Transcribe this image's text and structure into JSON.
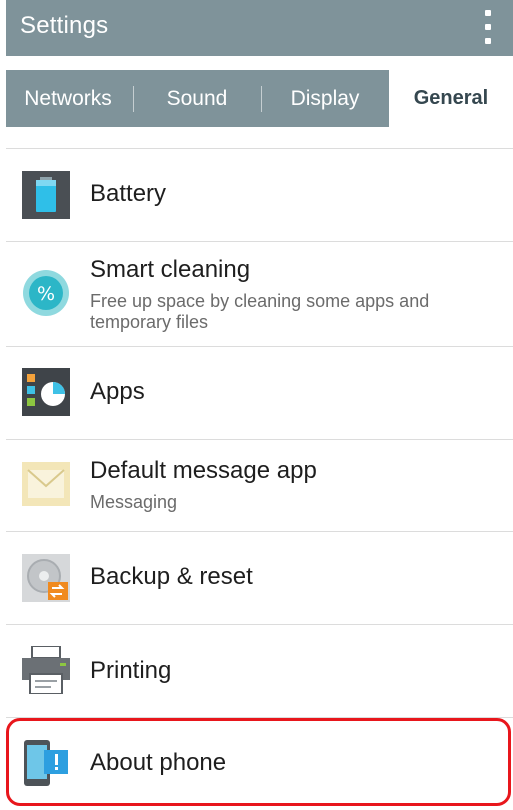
{
  "header": {
    "title": "Settings"
  },
  "tabs": [
    {
      "label": "Networks"
    },
    {
      "label": "Sound"
    },
    {
      "label": "Display"
    },
    {
      "label": "General",
      "active": true
    }
  ],
  "items": [
    {
      "label": "Battery",
      "icon": "battery-icon"
    },
    {
      "label": "Smart cleaning",
      "sub": "Free up space by cleaning some apps and temporary files",
      "icon": "smart-cleaning-icon"
    },
    {
      "label": "Apps",
      "icon": "apps-icon"
    },
    {
      "label": "Default message app",
      "sub": "Messaging",
      "icon": "message-envelope-icon"
    },
    {
      "label": "Backup & reset",
      "icon": "backup-reset-icon"
    },
    {
      "label": "Printing",
      "icon": "printer-icon"
    },
    {
      "label": "About phone",
      "icon": "about-phone-icon",
      "highlighted": true
    }
  ],
  "colors": {
    "header_bg": "#7f939a",
    "active_tab_text": "#35474f",
    "highlight_border": "#e8161c"
  }
}
